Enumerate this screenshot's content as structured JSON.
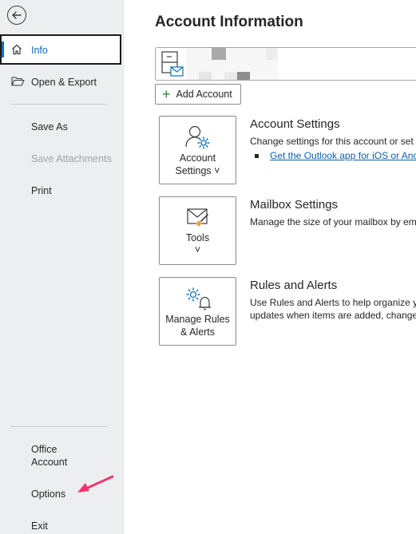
{
  "sidebar": {
    "items": [
      {
        "label": "Info"
      },
      {
        "label": "Open & Export"
      },
      {
        "label": "Save As"
      },
      {
        "label": "Save Attachments"
      },
      {
        "label": "Print"
      },
      {
        "label_line1": "Office",
        "label_line2": "Account"
      },
      {
        "label": "Options"
      },
      {
        "label": "Exit"
      }
    ]
  },
  "main": {
    "title": "Account Information",
    "add_account_label": "Add Account",
    "sections": [
      {
        "tile_line1": "Account",
        "tile_line2": "Settings ˅",
        "title": "Account Settings",
        "desc": "Change settings for this account or set u",
        "link": "Get the Outlook app for iOS or Anc"
      },
      {
        "tile_line1": "Tools",
        "tile_line2": "˅",
        "title": "Mailbox Settings",
        "desc": "Manage the size of your mailbox by em"
      },
      {
        "tile_line1": "Manage Rules",
        "tile_line2": "& Alerts",
        "title": "Rules and Alerts",
        "desc_line1": "Use Rules and Alerts to help organize yo",
        "desc_line2": "updates when items are added, changec"
      }
    ]
  },
  "icons": {
    "back": "back-arrow-icon",
    "info": "home-icon",
    "open_export": "folder-open-icon",
    "account_type": "exchange-mailbox-icon",
    "add": "plus-icon",
    "account_settings": "person-gear-icon",
    "tools": "mail-brush-icon",
    "rules": "gear-bell-icon",
    "annotation": "pink-arrow-icon"
  },
  "colors": {
    "accent": "#0f6cbd",
    "sidebar_bg": "#edeeef",
    "link": "#0f5fa8",
    "annotation_arrow": "#f0356e"
  }
}
